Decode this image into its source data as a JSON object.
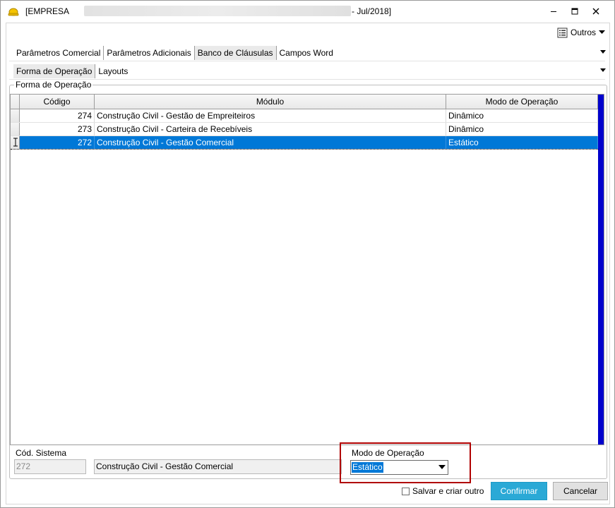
{
  "window": {
    "title_prefix": "[EMPRESA",
    "title_suffix": "- Jul/2018]",
    "minimize_icon": "minimize-icon",
    "maximize_icon": "maximize-icon",
    "close_icon": "close-icon"
  },
  "toolbar": {
    "outros_label": "Outros",
    "outros_icon": "list-icon"
  },
  "tabs_primary": [
    {
      "label": "Parâmetros Comercial",
      "active": false
    },
    {
      "label": "Parâmetros Adicionais",
      "active": false
    },
    {
      "label": "Banco de Cláusulas",
      "active": true
    },
    {
      "label": "Campos Word",
      "active": false
    }
  ],
  "tabs_secondary": [
    {
      "label": "Forma de Operação",
      "active": true
    },
    {
      "label": "Layouts",
      "active": false
    }
  ],
  "group": {
    "title": "Forma de Operação"
  },
  "grid": {
    "columns": [
      "Código",
      "Módulo",
      "Modo de Operação"
    ],
    "rows": [
      {
        "codigo": "274",
        "modulo": "Construção Civil - Gestão de Empreiteiros",
        "modo": "Dinâmico",
        "selected": false
      },
      {
        "codigo": "273",
        "modulo": "Construção Civil - Carteira de Recebíveis",
        "modo": "Dinâmico",
        "selected": false
      },
      {
        "codigo": "272",
        "modulo": "Construção Civil - Gestão Comercial",
        "modo": "Estático",
        "selected": true
      }
    ]
  },
  "form": {
    "cod_sistema_label": "Cód. Sistema",
    "cod_sistema_value": "272",
    "modulo_value": "Construção Civil - Gestão Comercial",
    "modo_label": "Modo de Operação",
    "modo_value": "Estático"
  },
  "footer": {
    "save_create_label": "Salvar e criar outro",
    "save_create_checked": false,
    "confirm_label": "Confirmar",
    "cancel_label": "Cancelar"
  },
  "colors": {
    "selection": "#0078d7",
    "confirm_button": "#2aa9d6",
    "highlight_border": "#b00000",
    "scroll_rail": "#0000cc"
  }
}
